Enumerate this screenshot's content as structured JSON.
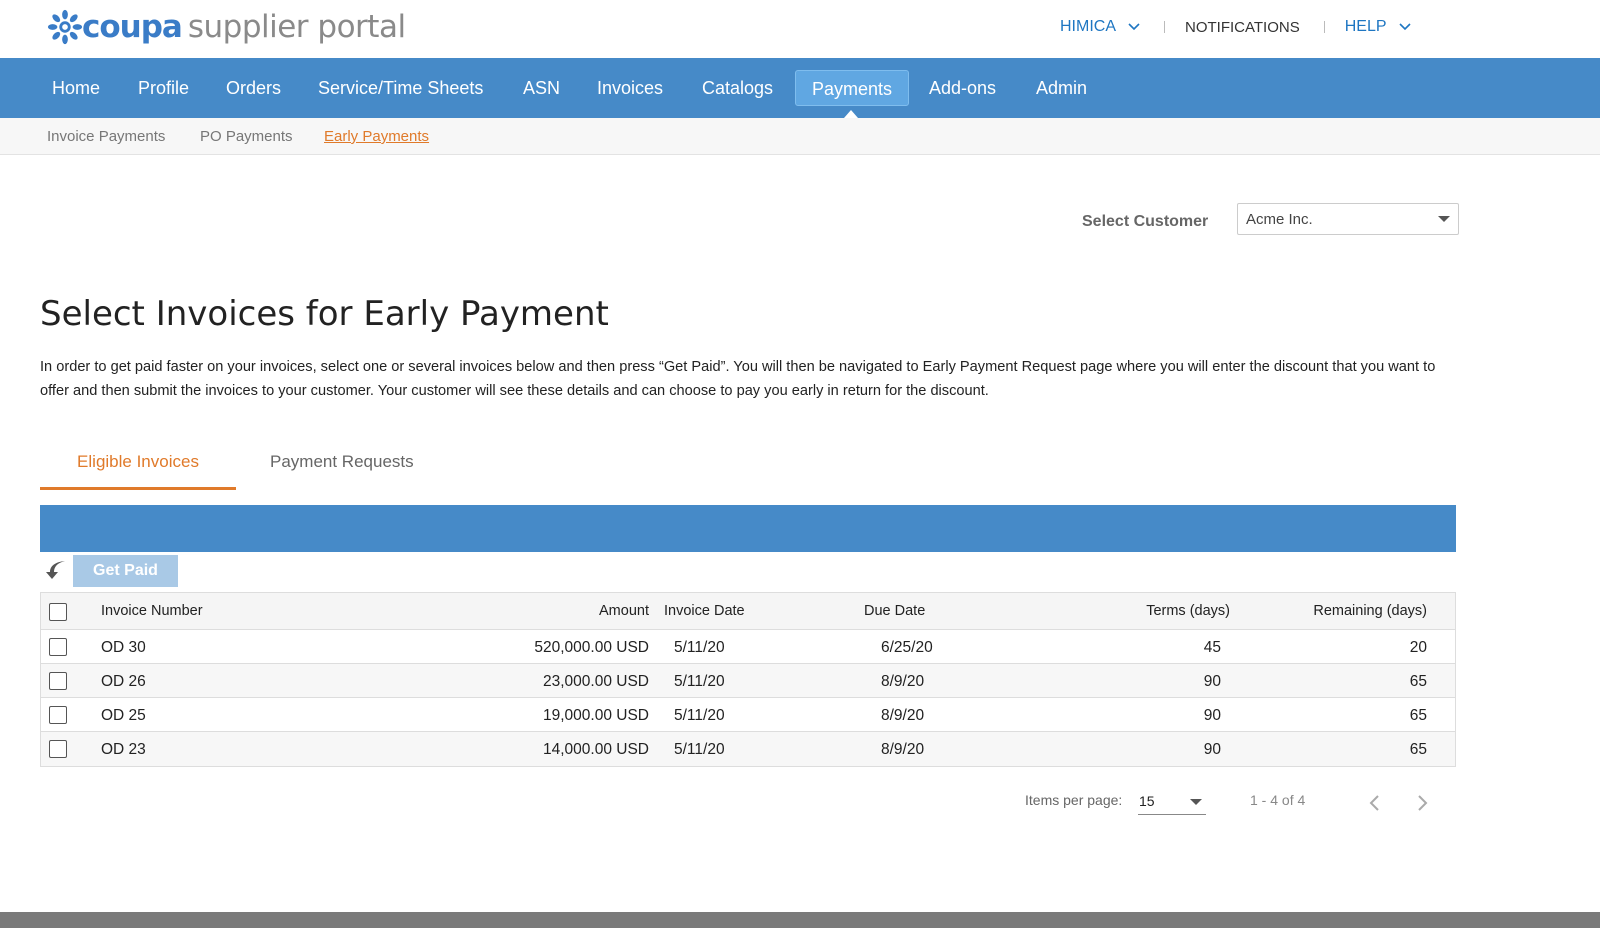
{
  "colors": {
    "brand_blue": "#468ac8",
    "accent_orange": "#e07a2a",
    "link_blue": "#1e76c2",
    "button_disabled": "#a9c9e6"
  },
  "brand": {
    "logo_icon": "coupa-flower-icon",
    "name_bold": "coupa",
    "name_rest": "supplier portal"
  },
  "top_links": {
    "user": "HIMICA",
    "notifications": "NOTIFICATIONS",
    "help": "HELP"
  },
  "nav": {
    "items": [
      "Home",
      "Profile",
      "Orders",
      "Service/Time Sheets",
      "ASN",
      "Invoices",
      "Catalogs",
      "Payments",
      "Add-ons",
      "Admin"
    ],
    "active": "Payments"
  },
  "subnav": {
    "items": [
      "Invoice Payments",
      "PO Payments",
      "Early Payments"
    ],
    "active": "Early Payments"
  },
  "customer": {
    "label": "Select Customer",
    "value": "Acme Inc."
  },
  "page": {
    "title": "Select Invoices for Early Payment",
    "intro": "In order to get paid faster on your invoices, select one or several invoices below and then press “Get Paid”. You will then be navigated to Early Payment Request page where you will enter the discount that you want to offer and then submit the invoices to your customer. Your customer will see these details and can choose to pay you early in return for the discount."
  },
  "tabs": {
    "eligible": "Eligible Invoices",
    "requests": "Payment Requests",
    "active": "Eligible Invoices"
  },
  "toolbar": {
    "back_icon": "back-arrow-icon",
    "get_paid": "Get Paid"
  },
  "table": {
    "columns": [
      "Invoice Number",
      "Amount",
      "Invoice Date",
      "Due Date",
      "Terms (days)",
      "Remaining (days)"
    ],
    "rows": [
      {
        "number": "OD 30",
        "amount": "520,000.00 USD",
        "invoice_date": "5/11/20",
        "due_date": "6/25/20",
        "terms": "45",
        "remaining": "20"
      },
      {
        "number": "OD 26",
        "amount": "23,000.00 USD",
        "invoice_date": "5/11/20",
        "due_date": "8/9/20",
        "terms": "90",
        "remaining": "65"
      },
      {
        "number": "OD 25",
        "amount": "19,000.00 USD",
        "invoice_date": "5/11/20",
        "due_date": "8/9/20",
        "terms": "90",
        "remaining": "65"
      },
      {
        "number": "OD 23",
        "amount": "14,000.00 USD",
        "invoice_date": "5/11/20",
        "due_date": "8/9/20",
        "terms": "90",
        "remaining": "65"
      }
    ]
  },
  "pagination": {
    "items_per_page_label": "Items per page:",
    "items_per_page": "15",
    "range": "1 - 4 of 4"
  }
}
